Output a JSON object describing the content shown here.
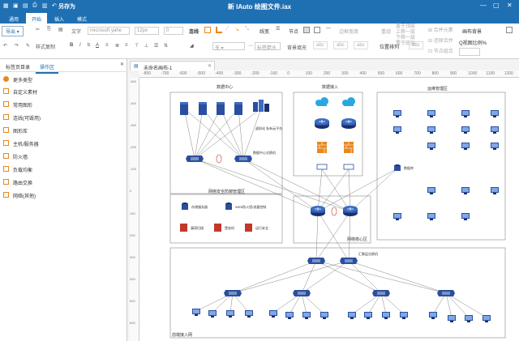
{
  "titlebar": {
    "save_as": "另存为",
    "title": "新 IAuto 绘图文件.iax"
  },
  "menu": {
    "tabs": [
      "通用",
      "开始",
      "插入",
      "模式"
    ],
    "active_tab": "开始"
  },
  "ribbon": {
    "export_label": "导出",
    "text_label": "文字",
    "font_value": "microsoft yahe",
    "size_value": "12px",
    "format_copy": "样式复制",
    "connect_label": "连线",
    "linewidth_label": "线宽",
    "node_label": "节点",
    "edge_width": "边框宽度",
    "none_value": "无",
    "label_style": "标签箭头",
    "bg_fill": "背景填充",
    "position": "位置排列",
    "arrange_top": "置于顶层",
    "arrange_up": "上移一层",
    "arrange_down": "下移一层",
    "arrange_bottom": "置于底层",
    "group_elements": "合并元素",
    "restore_merge": "还原合并",
    "node_group": "节点组合",
    "canvas_bg": "画布背景",
    "view_ratio": "视图比例%",
    "style_sample": "abc"
  },
  "panel": {
    "tabs": [
      "标签页目录",
      "操作区"
    ],
    "active_tab": "操作区",
    "items": [
      "更多类型",
      "自定义素材",
      "常用图形",
      "连线(可毁用)",
      "图形库",
      "主机/服务器",
      "防火墙",
      "负载均衡",
      "路由交换",
      "网络(其他)"
    ]
  },
  "document": {
    "tab_title": "未命名画布-1"
  },
  "rulers": {
    "h_ticks": [
      "-800",
      "-700",
      "-600",
      "-500",
      "-400",
      "-300",
      "-200",
      "-100",
      "0",
      "100",
      "200",
      "300",
      "400",
      "500",
      "600",
      "700",
      "800",
      "900",
      "1000",
      "1100",
      "1200"
    ],
    "v_ticks": [
      "-500",
      "-400",
      "-300",
      "-200",
      "-100",
      "0",
      "100",
      "200",
      "300",
      "400",
      "500",
      "600"
    ]
  },
  "diagram": {
    "zone_data_center": "数据中心",
    "zone_data_access": "数据接入",
    "zone_ops": "运维管理区",
    "zone_security": "网络安全防御管理区",
    "zone_core": "网络核心区",
    "zone_access": "前端接入网",
    "label_cloud_host": "虚拟化\n私有云平台",
    "label_dc_switch": "数据中心交换机",
    "label_storage": "存储服务器",
    "label_waf": "WEB防火墙/流量控制",
    "label_sec_audit": "漏洞扫描",
    "label_db_audit": "堡垒机",
    "label_ops_audit": "运行安全",
    "label_agg_switch": "汇聚层交换机",
    "label_db": "数据库"
  },
  "colors": {
    "brand": "#1f6fb3",
    "device": "#2a4f9e",
    "device_dark": "#1b2f6b",
    "firewall": "#e8871e",
    "cloud": "#29a8e0",
    "sec_red": "#c0392b"
  }
}
